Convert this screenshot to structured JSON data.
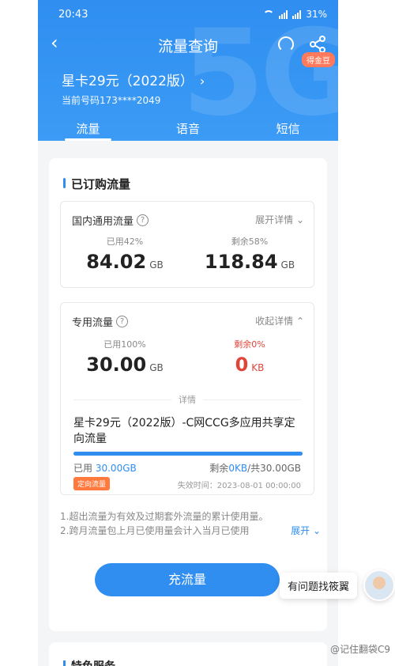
{
  "status": {
    "time": "20:43",
    "battery": "31%"
  },
  "nav": {
    "title": "流量查询",
    "coin_badge": "得金豆"
  },
  "plan": {
    "name": "星卡29元（2022版）",
    "number": "当前号码173****2049"
  },
  "tabs": [
    {
      "label": "流量",
      "active": true
    },
    {
      "label": "语音"
    },
    {
      "label": "短信"
    }
  ],
  "section": {
    "title": "已订购流量"
  },
  "domestic": {
    "title": "国内通用流量",
    "toggle": "展开详情",
    "used_label": "已用42%",
    "used_value": "84.02",
    "used_unit": "GB",
    "remain_label": "剩余58%",
    "remain_value": "118.84",
    "remain_unit": "GB"
  },
  "dedicated": {
    "title": "专用流量",
    "toggle": "收起详情",
    "used_label": "已用100%",
    "used_value": "30.00",
    "used_unit": "GB",
    "remain_label": "剩余0%",
    "remain_value": "0",
    "remain_unit": "KB",
    "details_divider": "详情",
    "package_name": "星卡29元（2022版）-C网CCG多应用共享定向流量",
    "progress_fraction": 1.0,
    "used_prefix": "已用",
    "used_amount": "30.00GB",
    "remain_prefix": "剩余",
    "remain_amount": "0KB",
    "remain_suffix": "/共30.00GB",
    "tag": "定向流量",
    "expire": "失效时间：2023-08-01 00:00:00"
  },
  "notes": {
    "line1": "1.超出流量为有效及过期套外流量的累计使用量。",
    "line2": "2.跨月流量包上月已使用量会计入当月已使用",
    "expand": "展开"
  },
  "recharge_button": "充流量",
  "help": {
    "bubble": "有问题找筱翼"
  },
  "next_section": {
    "title": "特色服务"
  },
  "watermark": "@记住翻袋C9",
  "colors": {
    "primary": "#2f8ef0",
    "danger": "#e0453a",
    "tag": "#ff7a3c"
  }
}
